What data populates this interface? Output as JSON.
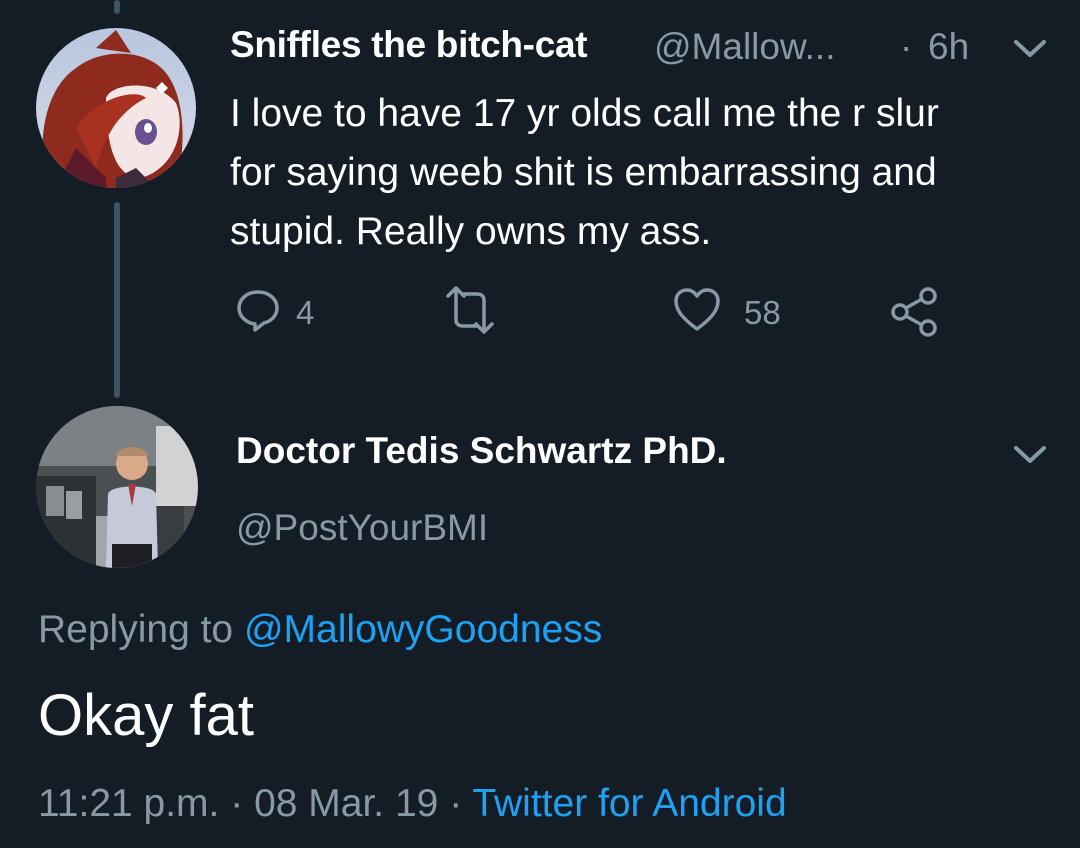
{
  "parent_tweet": {
    "display_name": "Sniffles the bitch-cat",
    "handle": "@Mallow...",
    "separator": "·",
    "time": "6h",
    "lines": [
      "I love to have 17 yr olds call me the r slur",
      "for saying weeb shit is embarrassing and",
      "stupid. Really owns my ass."
    ],
    "actions": {
      "reply_icon": "reply-bubble-icon",
      "reply_count": "4",
      "retweet_icon": "retweet-icon",
      "like_icon": "heart-icon",
      "like_count": "58",
      "share_icon": "share-icon"
    }
  },
  "reply_tweet": {
    "display_name": "Doctor Tedis Schwartz PhD.",
    "handle": "@PostYourBMI",
    "replying_prefix": "Replying to",
    "replying_mention": "@MallowyGoodness",
    "text": "Okay fat",
    "time": "11:21 p.m.",
    "sep1": "·",
    "date": "08 Mar. 19",
    "sep2": "·",
    "source": "Twitter for Android"
  },
  "colors": {
    "background": "#141d26",
    "text": "#ffffff",
    "muted": "#8899a6",
    "link": "#1da1f2",
    "thread_line": "#3d5466"
  }
}
